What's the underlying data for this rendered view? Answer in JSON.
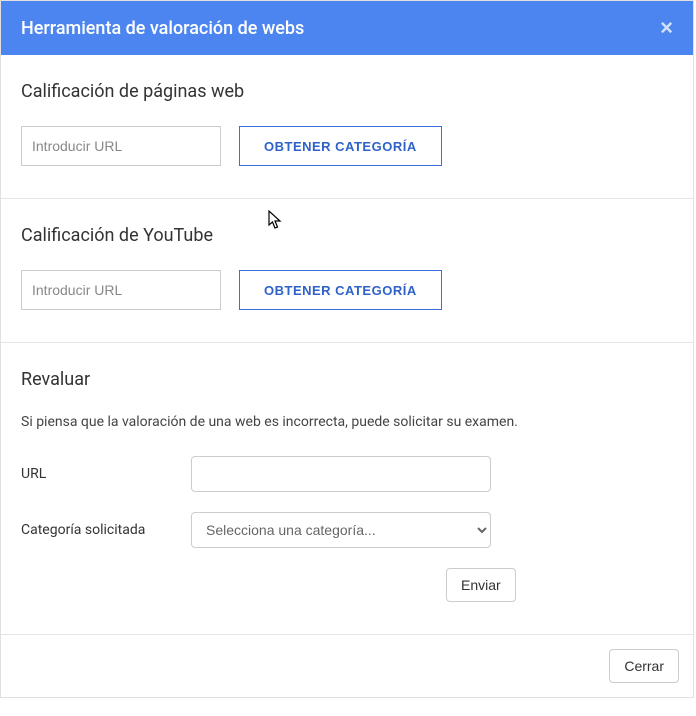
{
  "header": {
    "title": "Herramienta de valoración de webs"
  },
  "sections": {
    "web": {
      "heading": "Calificación de páginas web",
      "placeholder": "Introducir URL",
      "button": "OBTENER CATEGORÍA"
    },
    "youtube": {
      "heading": "Calificación de YouTube",
      "placeholder": "Introducir URL",
      "button": "OBTENER CATEGORÍA"
    },
    "reval": {
      "heading": "Revaluar",
      "description": "Si piensa que la valoración de una web es incorrecta, puede solicitar su examen.",
      "url_label": "URL",
      "url_value": "",
      "category_label": "Categoría solicitada",
      "category_selected": "Selecciona una categoría...",
      "send_label": "Enviar"
    }
  },
  "footer": {
    "close_label": "Cerrar"
  }
}
